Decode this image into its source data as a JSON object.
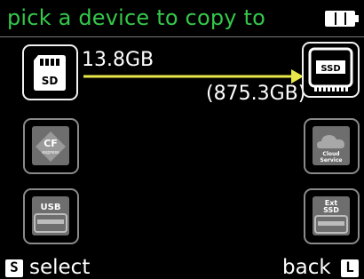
{
  "header": {
    "title": "pick a device to copy to",
    "battery_icon": "battery-icon"
  },
  "source": {
    "label": "SD",
    "size": "13.8GB",
    "icon": "sd-card-icon"
  },
  "target": {
    "label": "SSD",
    "size": "(875.3GB)",
    "icon": "ssd-icon"
  },
  "devices": {
    "cfexpress": {
      "label": "CF",
      "sublabel": "express",
      "icon": "cfexpress-icon"
    },
    "usb": {
      "label": "USB",
      "icon": "usb-drive-icon"
    },
    "cloud": {
      "label_line1": "Cloud",
      "label_line2": "Service",
      "icon": "cloud-icon"
    },
    "ext_ssd": {
      "label_line1": "Ext",
      "label_line2": "SSD",
      "icon": "ext-ssd-icon"
    }
  },
  "footer": {
    "select_key": "S",
    "select_label": "select",
    "back_label": "back",
    "back_key": "L"
  },
  "colors": {
    "title": "#34c84a",
    "arrow": "#e8e84a",
    "active_border": "#f2f2f2",
    "inactive_border": "#8a8a8a"
  }
}
